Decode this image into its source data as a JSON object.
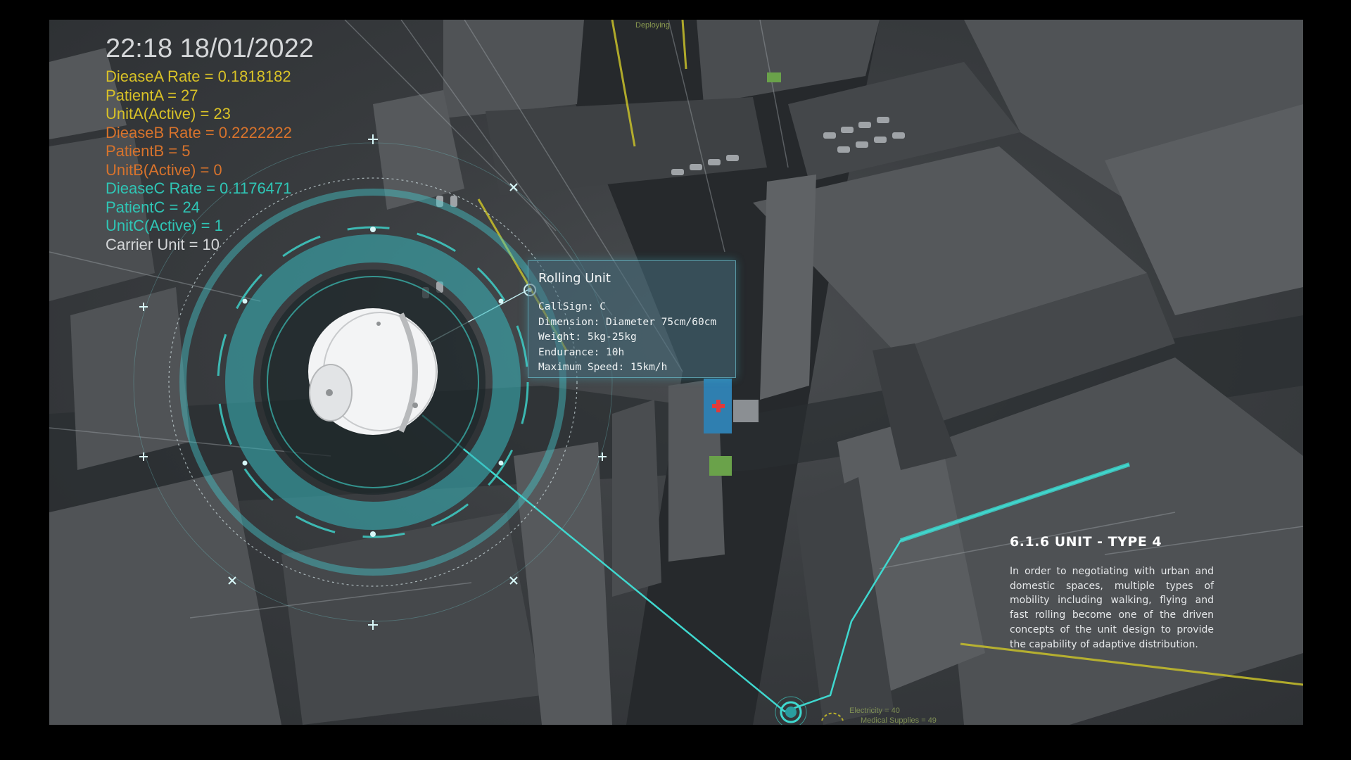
{
  "hud": {
    "clock": "22:18 18/01/2022",
    "stats": [
      {
        "text": "DieaseA Rate = 0.1818182",
        "color": "#d9c227"
      },
      {
        "text": "PatientA = 27",
        "color": "#d9c227"
      },
      {
        "text": "UnitA(Active) = 23",
        "color": "#d9c227"
      },
      {
        "text": "DieaseB Rate = 0.2222222",
        "color": "#d8732c"
      },
      {
        "text": "PatientB = 5",
        "color": "#d8732c"
      },
      {
        "text": "UnitB(Active) = 0",
        "color": "#d8732c"
      },
      {
        "text": "DieaseC Rate = 0.1176471",
        "color": "#2fc6b6"
      },
      {
        "text": "PatientC = 24",
        "color": "#2fc6b6"
      },
      {
        "text": "UnitC(Active) = 1",
        "color": "#2fc6b6"
      },
      {
        "text": "Carrier Unit = 10",
        "color": "#d4d6d8"
      }
    ]
  },
  "tooltip": {
    "title": "Rolling Unit",
    "rows": [
      "CallSign: C",
      "Dimension: Diameter 75cm/60cm",
      "Weight: 5kg-25kg",
      "Endurance: 10h",
      "Maximum Speed: 15km/h"
    ]
  },
  "section": {
    "title": "6.1.6 UNIT - TYPE 4",
    "body": "In order to negotiating with urban and domestic spaces, multiple types of mobility including walking, flying and fast rolling become one of the driven concepts of the unit design to provide the capability of adaptive distribution."
  },
  "map_labels": {
    "deploying": "Deploying",
    "electricity": "Electricity = 40",
    "medical_supplies": "Medical Supplies = 49"
  },
  "colors": {
    "accent": "#3fd8cf",
    "diseaseA": "#d9c227",
    "diseaseB": "#d8732c",
    "diseaseC": "#2fc6b6"
  },
  "icons": {
    "medical_cross": "red-cross-icon",
    "unit_marker": "target-ring-icon"
  }
}
